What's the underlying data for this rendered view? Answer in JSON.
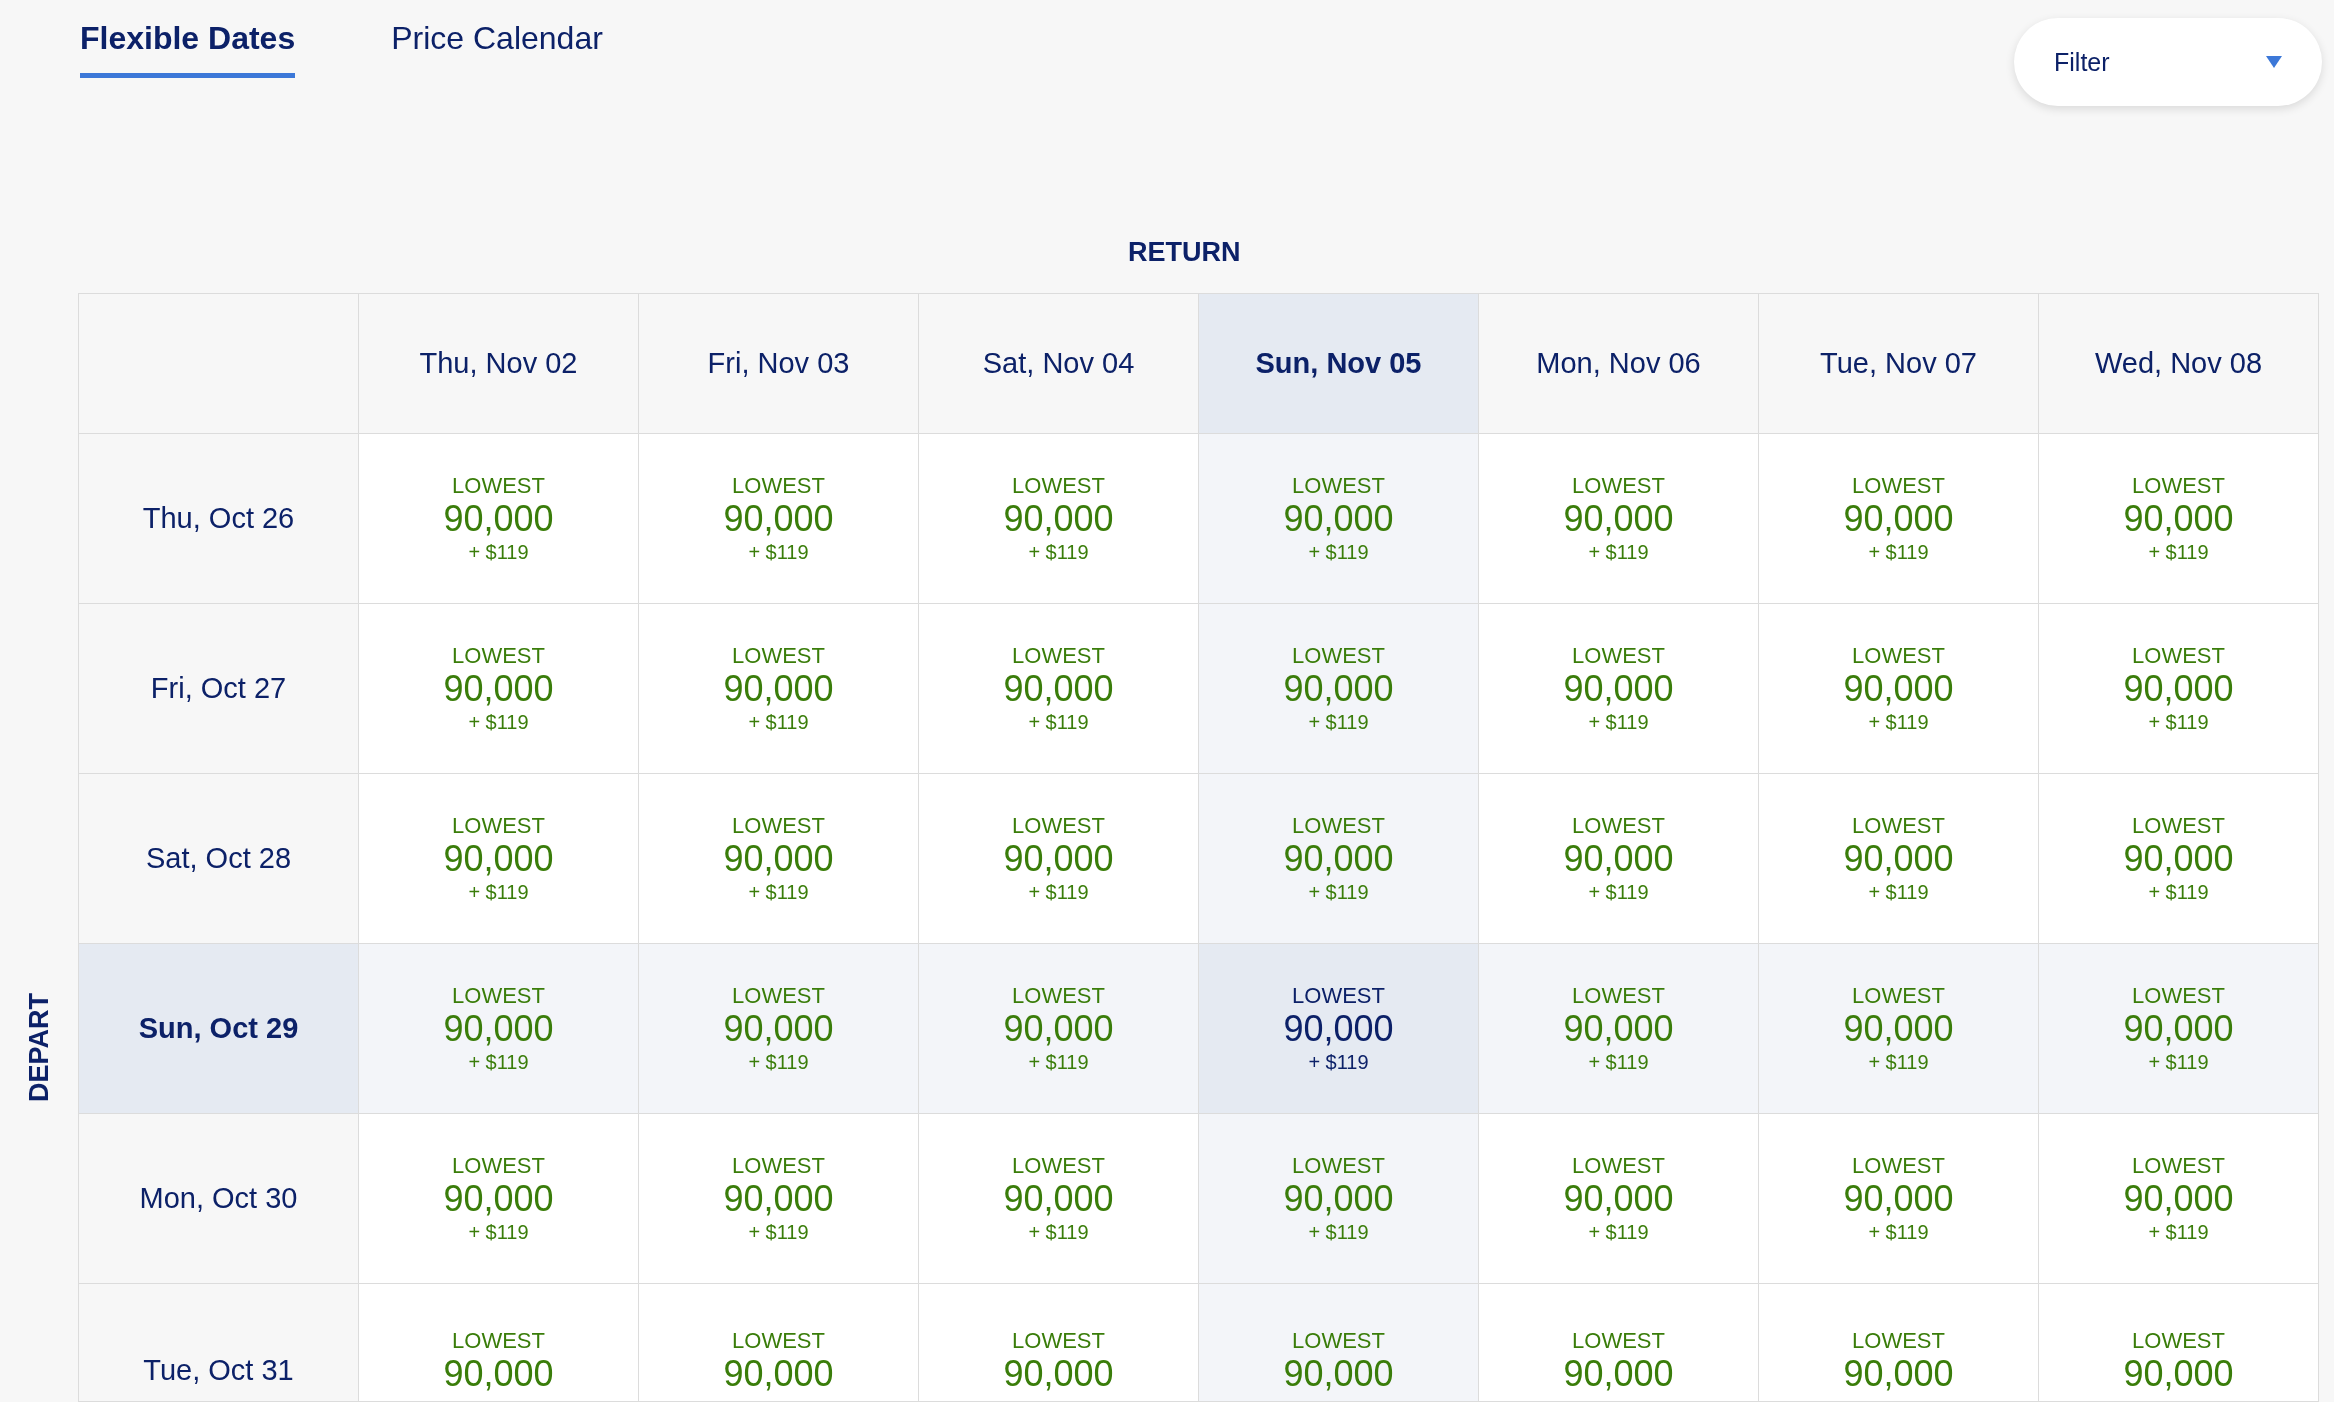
{
  "tabs": [
    {
      "label": "Flexible Dates",
      "selected": true
    },
    {
      "label": "Price Calendar",
      "selected": false
    }
  ],
  "filter": {
    "label": "Filter"
  },
  "return_label": "RETURN",
  "depart_label": "DEPART",
  "columns": [
    {
      "label": "Thu, Nov 02",
      "selected": false
    },
    {
      "label": "Fri, Nov 03",
      "selected": false
    },
    {
      "label": "Sat, Nov 04",
      "selected": false
    },
    {
      "label": "Sun, Nov 05",
      "selected": true
    },
    {
      "label": "Mon, Nov 06",
      "selected": false
    },
    {
      "label": "Tue, Nov 07",
      "selected": false
    },
    {
      "label": "Wed, Nov 08",
      "selected": false
    }
  ],
  "rows": [
    {
      "label": "Thu, Oct 26",
      "selected": false,
      "cells": [
        {
          "tag": "LOWEST",
          "points": "90,000",
          "fee": "+ $119"
        },
        {
          "tag": "LOWEST",
          "points": "90,000",
          "fee": "+ $119"
        },
        {
          "tag": "LOWEST",
          "points": "90,000",
          "fee": "+ $119"
        },
        {
          "tag": "LOWEST",
          "points": "90,000",
          "fee": "+ $119"
        },
        {
          "tag": "LOWEST",
          "points": "90,000",
          "fee": "+ $119"
        },
        {
          "tag": "LOWEST",
          "points": "90,000",
          "fee": "+ $119"
        },
        {
          "tag": "LOWEST",
          "points": "90,000",
          "fee": "+ $119"
        }
      ]
    },
    {
      "label": "Fri, Oct 27",
      "selected": false,
      "cells": [
        {
          "tag": "LOWEST",
          "points": "90,000",
          "fee": "+ $119"
        },
        {
          "tag": "LOWEST",
          "points": "90,000",
          "fee": "+ $119"
        },
        {
          "tag": "LOWEST",
          "points": "90,000",
          "fee": "+ $119"
        },
        {
          "tag": "LOWEST",
          "points": "90,000",
          "fee": "+ $119"
        },
        {
          "tag": "LOWEST",
          "points": "90,000",
          "fee": "+ $119"
        },
        {
          "tag": "LOWEST",
          "points": "90,000",
          "fee": "+ $119"
        },
        {
          "tag": "LOWEST",
          "points": "90,000",
          "fee": "+ $119"
        }
      ]
    },
    {
      "label": "Sat, Oct 28",
      "selected": false,
      "cells": [
        {
          "tag": "LOWEST",
          "points": "90,000",
          "fee": "+ $119"
        },
        {
          "tag": "LOWEST",
          "points": "90,000",
          "fee": "+ $119"
        },
        {
          "tag": "LOWEST",
          "points": "90,000",
          "fee": "+ $119"
        },
        {
          "tag": "LOWEST",
          "points": "90,000",
          "fee": "+ $119"
        },
        {
          "tag": "LOWEST",
          "points": "90,000",
          "fee": "+ $119"
        },
        {
          "tag": "LOWEST",
          "points": "90,000",
          "fee": "+ $119"
        },
        {
          "tag": "LOWEST",
          "points": "90,000",
          "fee": "+ $119"
        }
      ]
    },
    {
      "label": "Sun, Oct 29",
      "selected": true,
      "cells": [
        {
          "tag": "LOWEST",
          "points": "90,000",
          "fee": "+ $119"
        },
        {
          "tag": "LOWEST",
          "points": "90,000",
          "fee": "+ $119"
        },
        {
          "tag": "LOWEST",
          "points": "90,000",
          "fee": "+ $119"
        },
        {
          "tag": "LOWEST",
          "points": "90,000",
          "fee": "+ $119"
        },
        {
          "tag": "LOWEST",
          "points": "90,000",
          "fee": "+ $119"
        },
        {
          "tag": "LOWEST",
          "points": "90,000",
          "fee": "+ $119"
        },
        {
          "tag": "LOWEST",
          "points": "90,000",
          "fee": "+ $119"
        }
      ]
    },
    {
      "label": "Mon, Oct 30",
      "selected": false,
      "cells": [
        {
          "tag": "LOWEST",
          "points": "90,000",
          "fee": "+ $119"
        },
        {
          "tag": "LOWEST",
          "points": "90,000",
          "fee": "+ $119"
        },
        {
          "tag": "LOWEST",
          "points": "90,000",
          "fee": "+ $119"
        },
        {
          "tag": "LOWEST",
          "points": "90,000",
          "fee": "+ $119"
        },
        {
          "tag": "LOWEST",
          "points": "90,000",
          "fee": "+ $119"
        },
        {
          "tag": "LOWEST",
          "points": "90,000",
          "fee": "+ $119"
        },
        {
          "tag": "LOWEST",
          "points": "90,000",
          "fee": "+ $119"
        }
      ]
    },
    {
      "label": "Tue, Oct 31",
      "selected": false,
      "cells": [
        {
          "tag": "LOWEST",
          "points": "90,000"
        },
        {
          "tag": "LOWEST",
          "points": "90,000"
        },
        {
          "tag": "LOWEST",
          "points": "90,000"
        },
        {
          "tag": "LOWEST",
          "points": "90,000"
        },
        {
          "tag": "LOWEST",
          "points": "90,000"
        },
        {
          "tag": "LOWEST",
          "points": "90,000"
        },
        {
          "tag": "LOWEST",
          "points": "90,000"
        }
      ]
    }
  ]
}
